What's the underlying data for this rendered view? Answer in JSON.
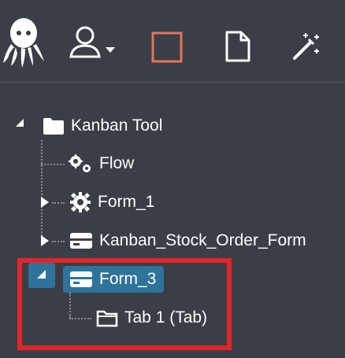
{
  "toolbar": {
    "icons": [
      "octopus-logo-icon",
      "user-icon",
      "square-icon",
      "document-icon",
      "magic-wand-icon"
    ],
    "accent": "#e8715a"
  },
  "tree": {
    "root": {
      "label": "Kanban Tool",
      "expanded": true
    },
    "children": [
      {
        "label": "Flow",
        "icon": "gears-icon"
      },
      {
        "label": "Form_1",
        "icon": "gear-icon",
        "expanded": false
      },
      {
        "label": "Kanban_Stock_Order_Form",
        "icon": "form-icon",
        "expanded": false
      },
      {
        "label": "Form_3",
        "icon": "form-icon",
        "expanded": true,
        "selected": true,
        "children": [
          {
            "label": "Tab 1 (Tab)",
            "icon": "folder-icon"
          }
        ]
      }
    ]
  },
  "colors": {
    "background": "#3a3f47",
    "selected": "#2e7399",
    "annotation": "#e3242b"
  }
}
